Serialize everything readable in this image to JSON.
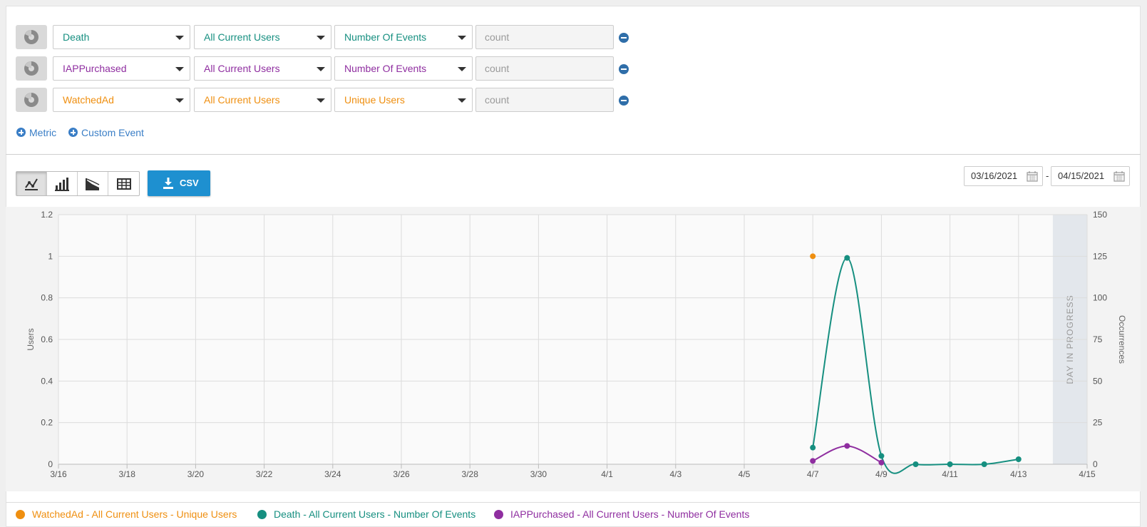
{
  "metric_rows": [
    {
      "event": "Death",
      "segment": "All Current Users",
      "measure": "Number Of Events",
      "agg_placeholder": "count",
      "color": "#168f80"
    },
    {
      "event": "IAPPurchased",
      "segment": "All Current Users",
      "measure": "Number Of Events",
      "agg_placeholder": "count",
      "color": "#8f2ea0"
    },
    {
      "event": "WatchedAd",
      "segment": "All Current Users",
      "measure": "Unique Users",
      "agg_placeholder": "count",
      "color": "#ef8f10"
    }
  ],
  "actions": {
    "add_metric": "Metric",
    "add_custom_event": "Custom Event"
  },
  "toolbar": {
    "csv_label": "CSV",
    "active_view": "line",
    "views": [
      "line-chart-icon",
      "bar-chart-icon",
      "area-chart-icon",
      "table-icon"
    ]
  },
  "date_range": {
    "start": "03/16/2021",
    "end": "04/15/2021",
    "separator": "-"
  },
  "chart_data": {
    "type": "line",
    "x_ticks": [
      "3/16",
      "3/18",
      "3/20",
      "3/22",
      "3/24",
      "3/26",
      "3/28",
      "3/30",
      "4/1",
      "4/3",
      "4/5",
      "4/7",
      "4/9",
      "4/11",
      "4/13",
      "4/15"
    ],
    "y_left": {
      "label": "Users",
      "ticks": [
        "1.2",
        "1",
        "0.8",
        "0.6",
        "0.4",
        "0.2",
        "0"
      ],
      "range": [
        0,
        1.2
      ]
    },
    "y_right": {
      "label": "Occurrences",
      "ticks": [
        "150",
        "125",
        "100",
        "75",
        "50",
        "25",
        "0"
      ],
      "range": [
        0,
        150
      ]
    },
    "in_progress_label": "DAY IN PROGRESS",
    "in_progress_range": [
      "4/14",
      "4/15"
    ],
    "grid": true,
    "series": [
      {
        "name": "Death - All Current Users - Number Of Events",
        "axis": "right",
        "color": "#168f80",
        "points": [
          {
            "x": "4/7",
            "y": 10
          },
          {
            "x": "4/8",
            "y": 124
          },
          {
            "x": "4/9",
            "y": 5
          },
          {
            "x": "4/10",
            "y": 0
          },
          {
            "x": "4/11",
            "y": 0
          },
          {
            "x": "4/12",
            "y": 0
          },
          {
            "x": "4/13",
            "y": 3
          }
        ]
      },
      {
        "name": "IAPPurchased - All Current Users - Number Of Events",
        "axis": "right",
        "color": "#8f2ea0",
        "points": [
          {
            "x": "4/7",
            "y": 2
          },
          {
            "x": "4/8",
            "y": 11
          },
          {
            "x": "4/9",
            "y": 1
          }
        ]
      },
      {
        "name": "WatchedAd - All Current Users - Unique Users",
        "axis": "left",
        "color": "#ef8f10",
        "points": [
          {
            "x": "4/7",
            "y": 1
          }
        ]
      }
    ]
  },
  "legend": [
    {
      "label": "WatchedAd - All Current Users - Unique Users",
      "color": "#ef8f10"
    },
    {
      "label": "Death - All Current Users - Number Of Events",
      "color": "#168f80"
    },
    {
      "label": "IAPPurchased - All Current Users - Number Of Events",
      "color": "#8f2ea0"
    }
  ]
}
